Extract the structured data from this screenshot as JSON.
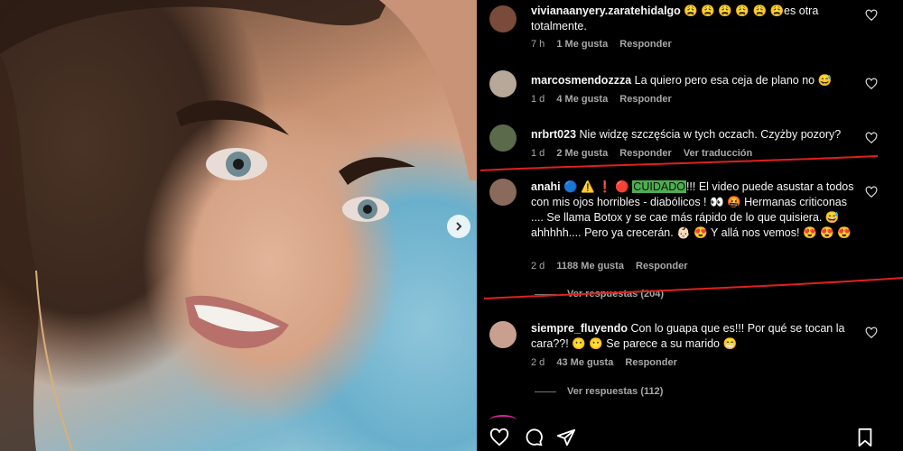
{
  "comments": [
    {
      "username": "vivianaanyery.zaratehidalgo",
      "text": "😩 😩 😩 😩 😩 😩es otra totalmente.",
      "time": "7 h",
      "likes": "1 Me gusta",
      "reply": "Responder",
      "avatar_color": "#7a4a3a"
    },
    {
      "username": "marcosmendozzza",
      "text": "La quiero pero esa ceja de plano no 😅",
      "time": "1 d",
      "likes": "4 Me gusta",
      "reply": "Responder",
      "avatar_color": "#b8a89a"
    },
    {
      "username": "nrbrt023",
      "text": "Nie widzę szczęścia w tych oczach. Czyżby pozory?",
      "time": "1 d",
      "likes": "2 Me gusta",
      "reply": "Responder",
      "translate": "Ver traducción",
      "avatar_color": "#5a6a4a"
    },
    {
      "username": "anahi",
      "text_pre": "🔵 ⚠️ ❗ 🔴 ",
      "highlight": "CUIDADO",
      "text_post": "!!! El video puede asustar a todos con mis ojos horribles - diabólicos ! 👀 🤬 Hermanas criticonas .... Se llama Botox y se cae más rápido de lo que quisiera. 😅 ahhhhh.... Pero ya crecerán. 👶🏻 😍 Y allá nos vemos! 😍 😍 😍",
      "time": "2 d",
      "likes": "1188 Me gusta",
      "reply": "Responder",
      "view_replies": "Ver respuestas (204)",
      "avatar_color": "#8a6a5a"
    },
    {
      "username": "siempre_fluyendo",
      "text": "Con lo guapa que es!!! Por qué se tocan la cara??! 😶 😶 Se parece a su marido 😁",
      "time": "2 d",
      "likes": "43 Me gusta",
      "reply": "Responder",
      "view_replies": "Ver respuestas (112)",
      "avatar_color": "#c9a090"
    }
  ],
  "annotation_color": "#e0211c",
  "icons": [
    "heart-icon",
    "comment-icon",
    "share-icon",
    "bookmark-icon",
    "chevron-right-icon"
  ]
}
